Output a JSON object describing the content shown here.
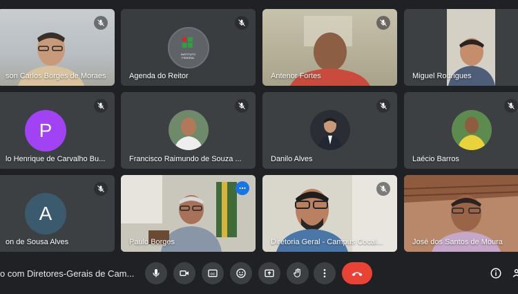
{
  "participants": [
    {
      "name": "son Carlos Borges de Moraes",
      "mic": "mic-off-icon"
    },
    {
      "name": "Agenda do Reitor",
      "mic": "mic-off-icon"
    },
    {
      "name": "Antenor Fortes",
      "mic": "mic-off-icon"
    },
    {
      "name": "Miguel Rodrigues",
      "mic": "mic-off-icon"
    },
    {
      "name": "lo Henrique de Carvalho Bu...",
      "avatar_letter": "P",
      "mic": "mic-off-icon"
    },
    {
      "name": "Francisco Raimundo de Souza ...",
      "mic": "mic-off-icon"
    },
    {
      "name": "Danilo Alves",
      "mic": "mic-off-icon"
    },
    {
      "name": "Laécio Barros",
      "mic": "mic-off-icon"
    },
    {
      "name": "on de Sousa Alves",
      "avatar_letter": "A",
      "mic": "mic-off-icon"
    },
    {
      "name": "Paulo Borges",
      "active": true
    },
    {
      "name": "Diretoria Geral - Campus Cocal...",
      "mic": "mic-off-icon"
    },
    {
      "name": "José dos Santos de Moura"
    }
  ],
  "logo_text": "INSTITUTO FEDERAL",
  "toolbar": {
    "meeting_title": "o com Diretores-Gerais de Cam...",
    "buttons": [
      "mic-icon",
      "camera-icon",
      "captions-icon",
      "emoji-icon",
      "present-icon",
      "raise-hand-icon",
      "more-vert-icon",
      "hangup-icon"
    ],
    "info": "info-icon"
  },
  "colors": {
    "background": "#202124",
    "tile": "#3c4043",
    "active_border": "#8ab4f8",
    "hangup": "#ea4335",
    "avatar_p": "#a142f4",
    "avatar_a": "#3c5a6e"
  }
}
